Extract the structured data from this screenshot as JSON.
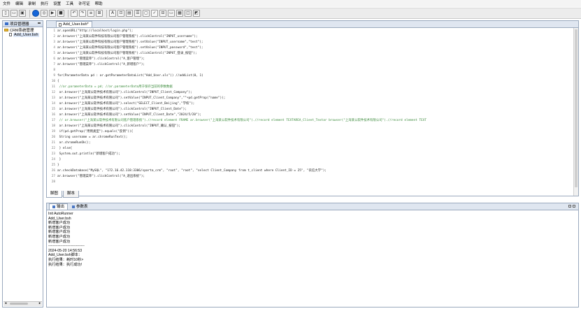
{
  "menu": [
    "文件",
    "编辑",
    "录制",
    "执行",
    "设置",
    "工具",
    "许可证",
    "帮助"
  ],
  "toolbar_icons": [
    "new-file-icon",
    "open-folder-icon",
    "save-icon",
    "record-icon",
    "stop-record-icon",
    "run-icon",
    "stop-icon",
    "undo-icon",
    "redo-icon",
    "align-icon",
    "tree-icon",
    "add-text-icon",
    "insert-icon",
    "table-icon",
    "list-icon",
    "comment-icon",
    "checkpoint-icon",
    "parameter-icon",
    "window-icon",
    "grid-icon",
    "browser-icon",
    "screenshot-icon"
  ],
  "project": {
    "tab_label": "项目管理器",
    "root": "CRM系统管理",
    "file": "Add_User.bsh"
  },
  "editor": {
    "tab_label": "Add_User.bsh*",
    "lines": [
      {
        "n": "1",
        "t": "ar.openURL(\"http://localhost/login.php\");"
      },
      {
        "n": "2",
        "t": "ar.browser(\"上海某公软件科技有限公司客户管理系统\").clickControl(\"INPUT_username\");"
      },
      {
        "n": "3",
        "t": "ar.browser(\"上海某公软件科技有限公司客户管理系统\").setValue(\"INPUT_username\",\"test\");"
      },
      {
        "n": "4",
        "t": "ar.browser(\"上海某公软件科技有限公司客户管理系统\").setValue(\"INPUT_password\",\"test\");"
      },
      {
        "n": "5",
        "t": "ar.browser(\"上海某公软件科技有限公司客户管理系统\").clickControl(\"INPUT_登录_按钮\");"
      },
      {
        "n": "6",
        "t": "ar.browser(\"管理菜单\").clickControl(\"A_客户管理\");"
      },
      {
        "n": "7",
        "t": "ar.browser(\"管理菜单\").clickControl(\"A_新增客户\");"
      },
      {
        "n": "8",
        "t": ""
      },
      {
        "n": "9",
        "t": "for(ParameterData pd : ar.getParameterDataList(\"Add_User.xls\")) //addList(0, 1)"
      },
      {
        "n": "10",
        "t": "{"
      },
      {
        "n": "11",
        "t": "    //ar.parameterData = pd; //ar.parameterData用于保存当前的参数数据"
      },
      {
        "n": "12",
        "t": "    ar.browser(\"上海某公软件技术有限公司\").clickControl(\"INPUT_Client_Company\");"
      },
      {
        "n": "13",
        "t": "    ar.browser(\"上海某公软件技术有限公司\").setValue(\"INPUT_Client_Company\",\"\"+pd.getProp(\"name\"));"
      },
      {
        "n": "14",
        "t": "    ar.browser(\"上海某公软件技术有限公司\").select(\"SELECT_Client_Beijing\",\"学校\");"
      },
      {
        "n": "15",
        "t": "    ar.browser(\"上海某公软件技术有限公司\").clickControl(\"INPUT_Client_Date\");"
      },
      {
        "n": "16",
        "t": "    ar.browser(\"上海某公软件技术有限公司\").setValue(\"INPUT_Client_Date\",\"2024/5/20\");"
      },
      {
        "n": "17",
        "t": "    // ar.browser(\"上海某公软件技术有限公司客户管理系统\").//record element FRAME ar.browser(\"上海某公软件技术有限公司\").//record element TEXTAREA_Client_Textar browser(\"上海某公软件技术有限公司\").//record element TEXT"
      },
      {
        "n": "18",
        "t": "    ar.browser(\"上海某公软件技术有限公司\").clickControl(\"INPUT_确认_按钮\");"
      },
      {
        "n": "19",
        "t": "    if(pd.getProp(\"用例类型\").equals(\"反例\")){"
      },
      {
        "n": "20",
        "t": "        String username = ar.chromeRunText();"
      },
      {
        "n": "21",
        "t": "        ar.chromeRunOk();"
      },
      {
        "n": "22",
        "t": "    } else{"
      },
      {
        "n": "23",
        "t": "        System.out.println(\"新增客户成功\");"
      },
      {
        "n": "24",
        "t": "    }"
      },
      {
        "n": "25",
        "t": "}"
      },
      {
        "n": "26",
        "t": "ar.checkDatabase(\"MySQL\", \"172.16.42.118:3306/sparta_crm\", \"root\", \"root\", \"select Client_Company from t_client where Client_ID = 25\", \"农信大学\");"
      },
      {
        "n": "27",
        "t": "ar.browser(\"管理菜单\").clickControl(\"A_退出系统\");"
      },
      {
        "n": "28",
        "t": ""
      }
    ]
  },
  "bottom_tabs": [
    "脚图",
    "脚本"
  ],
  "console": {
    "tabs": [
      "输出",
      "参数表"
    ],
    "lines": [
      "Init AutoRunner",
      "Add_User.bsh",
      "新增客户成功",
      "新增客户成功",
      "新增客户成功",
      "新增客户成功",
      "新增客户成功",
      "------------------------------",
      "2024-05-20 14:56:53",
      "Add_User.bsh脚本：",
      "执行结果：耗时10秒>",
      "执行结果：执行成功!"
    ]
  }
}
